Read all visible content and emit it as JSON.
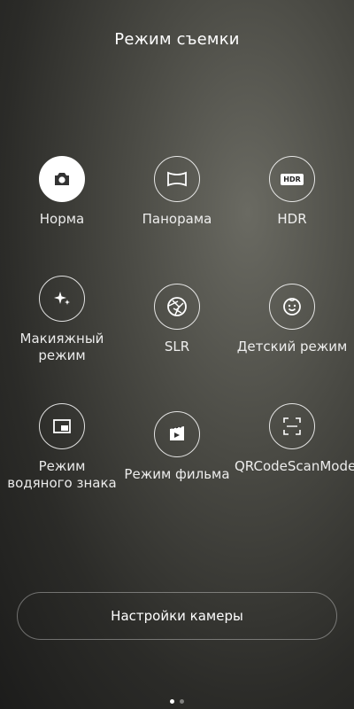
{
  "header": {
    "title": "Режим съемки"
  },
  "modes": [
    {
      "label": "Норма",
      "icon": "camera-icon",
      "selected": true
    },
    {
      "label": "Панорама",
      "icon": "panorama-icon"
    },
    {
      "label": "HDR",
      "icon": "hdr-icon",
      "badge": "HDR"
    },
    {
      "label": "Макияжный режим",
      "icon": "sparkle-icon"
    },
    {
      "label": "SLR",
      "icon": "aperture-icon"
    },
    {
      "label": "Детский режим",
      "icon": "baby-face-icon"
    },
    {
      "label": "Режим водяного знака",
      "icon": "watermark-icon"
    },
    {
      "label": "Режим фильма",
      "icon": "film-icon"
    },
    {
      "label": "QRCodeScanMode",
      "icon": "qr-scan-icon"
    }
  ],
  "settings_button": {
    "label": "Настройки камеры"
  },
  "pager": {
    "pages": 2,
    "current": 1
  }
}
